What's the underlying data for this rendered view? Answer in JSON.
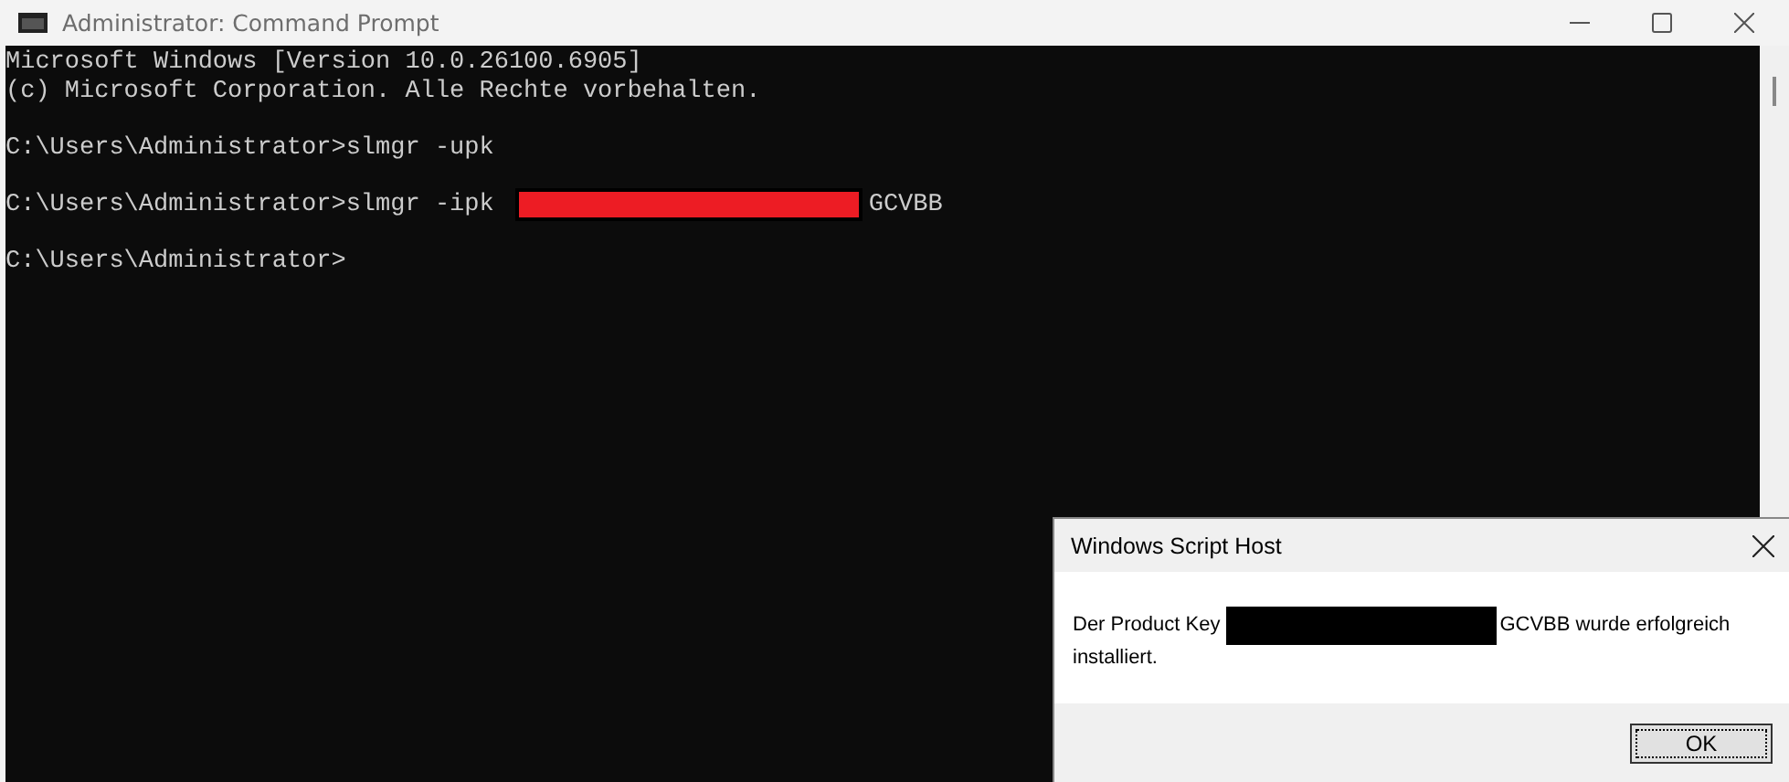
{
  "console": {
    "title": "Administrator: Command Prompt",
    "lines": [
      {
        "kind": "text",
        "segments": [
          {
            "kind": "text",
            "text": "Microsoft Windows [Version 10.0.26100.6905]"
          }
        ]
      },
      {
        "kind": "text",
        "segments": [
          {
            "kind": "text",
            "text": "(c) Microsoft Corporation. Alle Rechte vorbehalten."
          }
        ]
      },
      {
        "kind": "blank"
      },
      {
        "kind": "text",
        "segments": [
          {
            "kind": "text",
            "text": "C:\\Users\\Administrator>slmgr -upk"
          }
        ]
      },
      {
        "kind": "blank"
      },
      {
        "kind": "text",
        "segments": [
          {
            "kind": "text",
            "text": "C:\\Users\\Administrator>slmgr -ipk"
          },
          {
            "kind": "redaction"
          },
          {
            "kind": "text",
            "text": "GCVBB"
          }
        ]
      },
      {
        "kind": "blank"
      },
      {
        "kind": "text",
        "segments": [
          {
            "kind": "text",
            "text": "C:\\Users\\Administrator>"
          }
        ]
      }
    ]
  },
  "dialog": {
    "title": "Windows Script Host",
    "message": [
      {
        "kind": "text",
        "text": "Der Product Key"
      },
      {
        "kind": "redaction"
      },
      {
        "kind": "text",
        "text": "GCVBB wurde erfolgreich"
      },
      {
        "kind": "text",
        "text": "installiert."
      }
    ],
    "button": "OK"
  }
}
